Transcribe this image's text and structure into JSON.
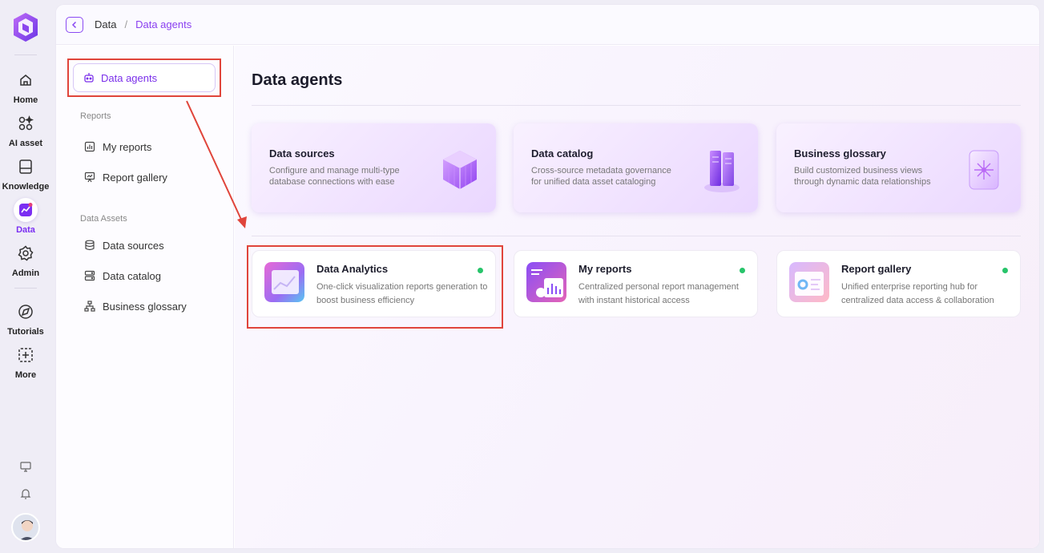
{
  "rail": {
    "items": [
      {
        "label": "Home",
        "icon": "home-icon"
      },
      {
        "label": "AI asset",
        "icon": "ai-asset-icon"
      },
      {
        "label": "Knowledge",
        "icon": "knowledge-icon"
      },
      {
        "label": "Data",
        "icon": "data-icon",
        "active": true
      },
      {
        "label": "Admin",
        "icon": "gear-icon"
      },
      {
        "label": "Tutorials",
        "icon": "compass-icon"
      },
      {
        "label": "More",
        "icon": "plus-square-icon"
      }
    ]
  },
  "breadcrumb": {
    "root": "Data",
    "separator": "/",
    "current": "Data agents"
  },
  "sidebar": {
    "agents_label": "Data agents",
    "reports_section": "Reports",
    "reports_items": [
      {
        "label": "My reports",
        "icon": "chart-icon"
      },
      {
        "label": "Report gallery",
        "icon": "gallery-icon"
      }
    ],
    "assets_section": "Data Assets",
    "assets_items": [
      {
        "label": "Data sources",
        "icon": "database-icon"
      },
      {
        "label": "Data catalog",
        "icon": "catalog-icon"
      },
      {
        "label": "Business glossary",
        "icon": "hierarchy-icon"
      }
    ]
  },
  "main": {
    "title": "Data agents",
    "top_cards": [
      {
        "title": "Data sources",
        "desc": "Configure and manage multi-type database connections with ease"
      },
      {
        "title": "Data catalog",
        "desc": "Cross-source metadata governance for unified data asset cataloging"
      },
      {
        "title": "Business glossary",
        "desc": "Build customized business views through dynamic data relationships"
      }
    ],
    "bottom_cards": [
      {
        "title": "Data Analytics",
        "desc": "One-click visualization reports generation to boost business efficiency"
      },
      {
        "title": "My reports",
        "desc": "Centralized personal report management with instant historical access"
      },
      {
        "title": "Report gallery",
        "desc": "Unified enterprise reporting hub for centralized data access & collaboration"
      }
    ]
  },
  "colors": {
    "accent": "#7b2ff2",
    "highlight": "#e0453b",
    "status_online": "#27c46a"
  }
}
